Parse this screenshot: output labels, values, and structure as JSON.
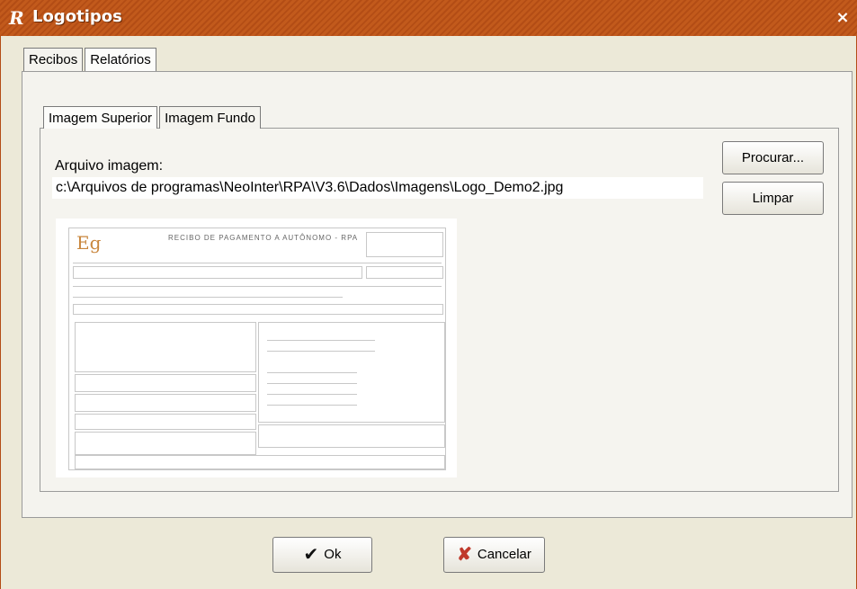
{
  "window": {
    "title": "Logotipos",
    "logo_glyph": "R",
    "close_glyph": "×"
  },
  "tabs_outer": [
    {
      "label": "Recibos"
    },
    {
      "label": "Relatórios"
    }
  ],
  "tabs_inner": [
    {
      "label": "Imagem Superior"
    },
    {
      "label": "Imagem Fundo"
    }
  ],
  "file": {
    "label": "Arquivo imagem:",
    "path": "c:\\Arquivos de programas\\NeoInter\\RPA\\V3.6\\Dados\\Imagens\\Logo_Demo2.jpg"
  },
  "buttons": {
    "browse": "Procurar...",
    "clear": "Limpar",
    "ok": "Ok",
    "cancel": "Cancelar"
  },
  "preview": {
    "logo_text": "Eg",
    "heading": "RECIBO DE PAGAMENTO A AUTÔNOMO - RPA"
  },
  "icons": {
    "ok": "check-icon",
    "cancel": "x-icon",
    "close": "close-icon"
  },
  "colors": {
    "titlebar": "#c25a1c",
    "cancel_icon": "#c0392b"
  }
}
